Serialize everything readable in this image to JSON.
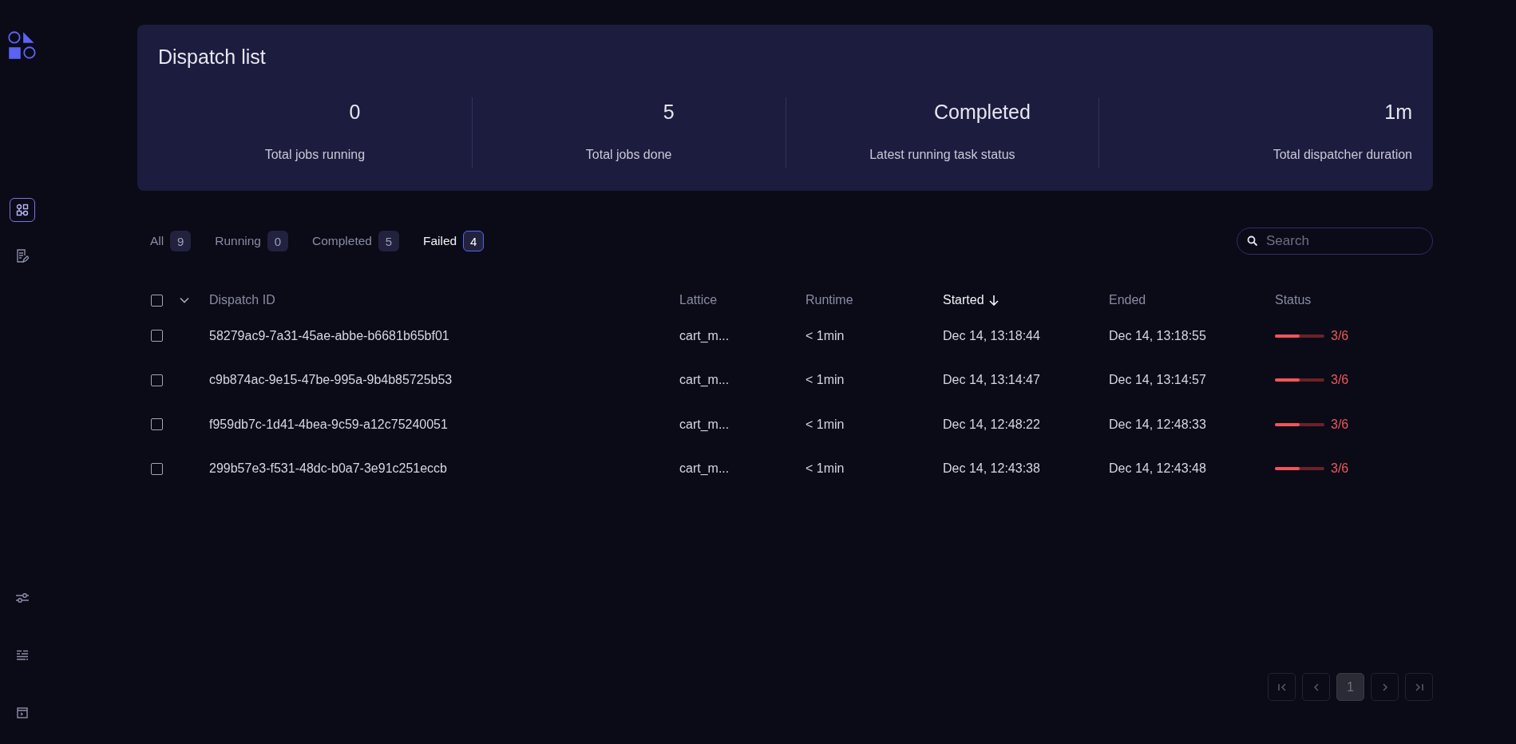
{
  "sidebar": {
    "items": [
      {
        "kind": "lattice",
        "selected": true
      },
      {
        "kind": "logs",
        "selected": false
      }
    ],
    "bottom_items": [
      {
        "kind": "sliders"
      },
      {
        "kind": "list"
      },
      {
        "kind": "window"
      }
    ]
  },
  "header": {
    "title": "Dispatch list",
    "stats": [
      {
        "value": "0",
        "label": "Total jobs running"
      },
      {
        "value": "5",
        "label": "Total jobs done"
      },
      {
        "value": "Completed",
        "label": "Latest running task status"
      },
      {
        "value": "1m",
        "label": "Total dispatcher duration"
      }
    ]
  },
  "filters": [
    {
      "label": "All",
      "count": "9",
      "selected": false
    },
    {
      "label": "Running",
      "count": "0",
      "selected": false
    },
    {
      "label": "Completed",
      "count": "5",
      "selected": false
    },
    {
      "label": "Failed",
      "count": "4",
      "selected": true
    }
  ],
  "search": {
    "placeholder": "Search"
  },
  "table": {
    "select_all_checked": false,
    "columns": [
      {
        "label": "Dispatch ID",
        "sorted": false
      },
      {
        "label": "Lattice",
        "sorted": false
      },
      {
        "label": "Runtime",
        "sorted": false
      },
      {
        "label": "Started",
        "sorted": true
      },
      {
        "label": "Ended",
        "sorted": false
      },
      {
        "label": "Status",
        "sorted": false
      }
    ],
    "rows": [
      {
        "checked": false,
        "id": "58279ac9-7a31-45ae-abbe-b6681b65bf01",
        "lattice": "cart_m...",
        "runtime": "< 1min",
        "started": "Dec 14, 13:18:44",
        "ended": "Dec 14, 13:18:55",
        "level": 0.5,
        "status": "3/6"
      },
      {
        "checked": false,
        "id": "c9b874ac-9e15-47be-995a-9b4b85725b53",
        "lattice": "cart_m...",
        "runtime": "< 1min",
        "started": "Dec 14, 13:14:47",
        "ended": "Dec 14, 13:14:57",
        "level": 0.5,
        "status": "3/6"
      },
      {
        "checked": false,
        "id": "f959db7c-1d41-4bea-9c59-a12c75240051",
        "lattice": "cart_m...",
        "runtime": "< 1min",
        "started": "Dec 14, 12:48:22",
        "ended": "Dec 14, 12:48:33",
        "level": 0.5,
        "status": "3/6"
      },
      {
        "checked": false,
        "id": "299b57e3-f531-48dc-b0a7-3e91c251eccb",
        "lattice": "cart_m...",
        "runtime": "< 1min",
        "started": "Dec 14, 12:43:38",
        "ended": "Dec 14, 12:43:48",
        "level": 0.5,
        "status": "3/6"
      }
    ]
  },
  "pagination": {
    "pages": [
      {
        "label": "1",
        "selected": true
      }
    ]
  }
}
